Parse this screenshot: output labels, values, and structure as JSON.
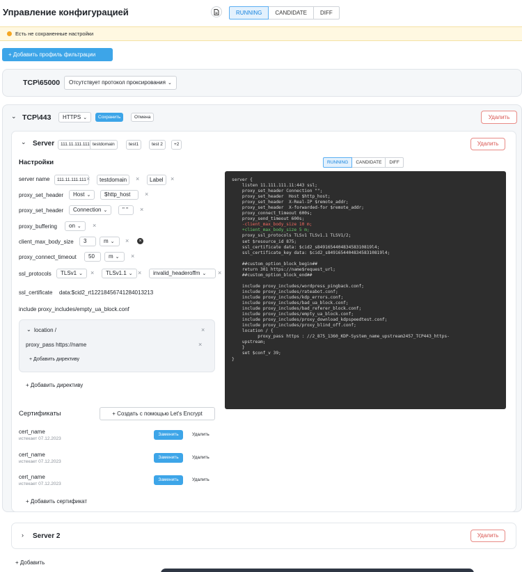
{
  "header": {
    "title": "Управление конфигурацией",
    "doc_icon": "document-icon",
    "tabs": [
      {
        "label": "RUNNING",
        "active": true
      },
      {
        "label": "CANDIDATE",
        "active": false
      },
      {
        "label": "DIFF",
        "active": false
      }
    ]
  },
  "warning": {
    "text": "Есть не сохраненные настройки",
    "color": "#f5a623"
  },
  "add_profile": "+ Добавить профиль фильтрации",
  "tcp65000": {
    "title": "TCP\\65000",
    "proxy": "Отсутствует протокол проксирования"
  },
  "tcp443": {
    "title": "TCP\\443",
    "protocol": "HTTPS",
    "save": "Сохранить",
    "cancel": "Отмена",
    "delete": "Удалить"
  },
  "server1": {
    "title": "Server",
    "chips": [
      "111.11.111.111",
      "testdomain",
      "test1",
      "test 2",
      "+2"
    ],
    "delete": "Удалить",
    "settings_title": "Настройки",
    "subtabs": [
      {
        "label": "RUNNING",
        "active": true
      },
      {
        "label": "CANDIDATE",
        "active": false
      },
      {
        "label": "DIFF",
        "active": false
      }
    ],
    "rows": {
      "server_name": {
        "label": "server name",
        "values": [
          "111.11.111.111",
          "testdomain",
          "Label"
        ]
      },
      "proxy_set_header_1": {
        "label": "proxy_set_header",
        "key": "Host",
        "value": "$http_host"
      },
      "proxy_set_header_2": {
        "label": "proxy_set_header",
        "key": "Connection",
        "value": "\" \""
      },
      "proxy_buffering": {
        "label": "proxy_buffering",
        "value": "on"
      },
      "client_max_body_size": {
        "label": "client_max_body_size",
        "value": "3",
        "unit": "m"
      },
      "proxy_connect_timeout": {
        "label": "proxy_connect_timeout",
        "value": "50",
        "unit": "m"
      },
      "ssl_protocols": {
        "label": "ssl_protocols",
        "values": [
          "TLSv1",
          "TLSv1.1",
          "invalid_headeroffm"
        ]
      },
      "ssl_certificate": {
        "label": "ssl_certificate",
        "value": "data:$cid2_rt12218456741284013213"
      },
      "include": "include proxy_includes/empty_ua_block.conf"
    },
    "location": {
      "title": "location /",
      "proxy_pass": "proxy_pass https://name",
      "add_directive": "+ Добавить директиву"
    },
    "add_directive": "+ Добавить директиву",
    "certificates": {
      "title": "Сертификаты",
      "create": "+ Создать с помощью Let's Encrypt",
      "items": [
        {
          "name": "cert_name",
          "expires": "истекает 07.12.2023",
          "replace": "Заменить",
          "delete": "Удалить"
        },
        {
          "name": "cert_name",
          "expires": "истекает 07.12.2023",
          "replace": "Заменить",
          "delete": "Удалить"
        },
        {
          "name": "cert_name",
          "expires": "истекает 07.12.2023",
          "replace": "Заменить",
          "delete": "Удалить"
        }
      ],
      "add": "+ Добавить сертификат"
    },
    "config_lines": [
      {
        "t": "server {",
        "c": "n"
      },
      {
        "t": "    listen 11.111.111.11:443 ssl;",
        "c": "n"
      },
      {
        "t": "    proxy_set_header Connection \"\";",
        "c": "n"
      },
      {
        "t": "    proxy_set_header  Host $http_host;",
        "c": "n"
      },
      {
        "t": "    proxy_set_header  X-Real-IP $remote_addr;",
        "c": "n"
      },
      {
        "t": "    proxy_set_header  X-forwarded-for $remote_addr;",
        "c": "n"
      },
      {
        "t": "    proxy_connect_timeout 600s;",
        "c": "n"
      },
      {
        "t": "    proxy_send_timeout 600s;",
        "c": "n"
      },
      {
        "t": "    -client_max_body_size 10 m;",
        "c": "red"
      },
      {
        "t": "    +client_max_body_size 5 m;",
        "c": "green"
      },
      {
        "t": "    proxy_ssl_protocols TLSv1 TLSv1.1 TLSV1/2;",
        "c": "n"
      },
      {
        "t": "    set $resource_id 875;",
        "c": "n"
      },
      {
        "t": "    ssl_certificate data: $cid2_s849165440483458310819l4;",
        "c": "n"
      },
      {
        "t": "    ssl_certificate_key data: $cid2_s849165440483458310819l4;",
        "c": "n"
      },
      {
        "t": "",
        "c": "n"
      },
      {
        "t": "    ##custom_option_block_begin##",
        "c": "n"
      },
      {
        "t": "    return 301 https://name$request_url;",
        "c": "n"
      },
      {
        "t": "    ##custom_option_block_end##",
        "c": "n"
      },
      {
        "t": "",
        "c": "n"
      },
      {
        "t": "    include proxy_includes/wordpress_pingback.conf;",
        "c": "n"
      },
      {
        "t": "    include proxy_includes/rateabot.conf;",
        "c": "n"
      },
      {
        "t": "    include proxy_includes/kdp_errors.conf;",
        "c": "n"
      },
      {
        "t": "    include proxy_includes/bad_ua_block.conf;",
        "c": "n"
      },
      {
        "t": "    include proxy_includes/bad_referer_block.conf;",
        "c": "n"
      },
      {
        "t": "    include proxy_includes/empty_ua_block.conf;",
        "c": "n"
      },
      {
        "t": "    include proxy_includes/proxy_download_kdpspeedtest.conf;",
        "c": "n"
      },
      {
        "t": "    include proxy_includes/proxy_blind_off.conf;",
        "c": "n"
      },
      {
        "t": "    location / {",
        "c": "n"
      },
      {
        "t": "          proxy_pass https : //2_875_1360_KDP-System_name_upstream2457_TCP443_https-",
        "c": "n"
      },
      {
        "t": "    upstream;",
        "c": "n"
      },
      {
        "t": "    }",
        "c": "n"
      },
      {
        "t": "    set $conf_v 39;",
        "c": "n"
      },
      {
        "t": "}",
        "c": "n"
      }
    ]
  },
  "server2": {
    "title": "Server 2",
    "delete": "Удалить"
  },
  "add": "+ Добавить"
}
